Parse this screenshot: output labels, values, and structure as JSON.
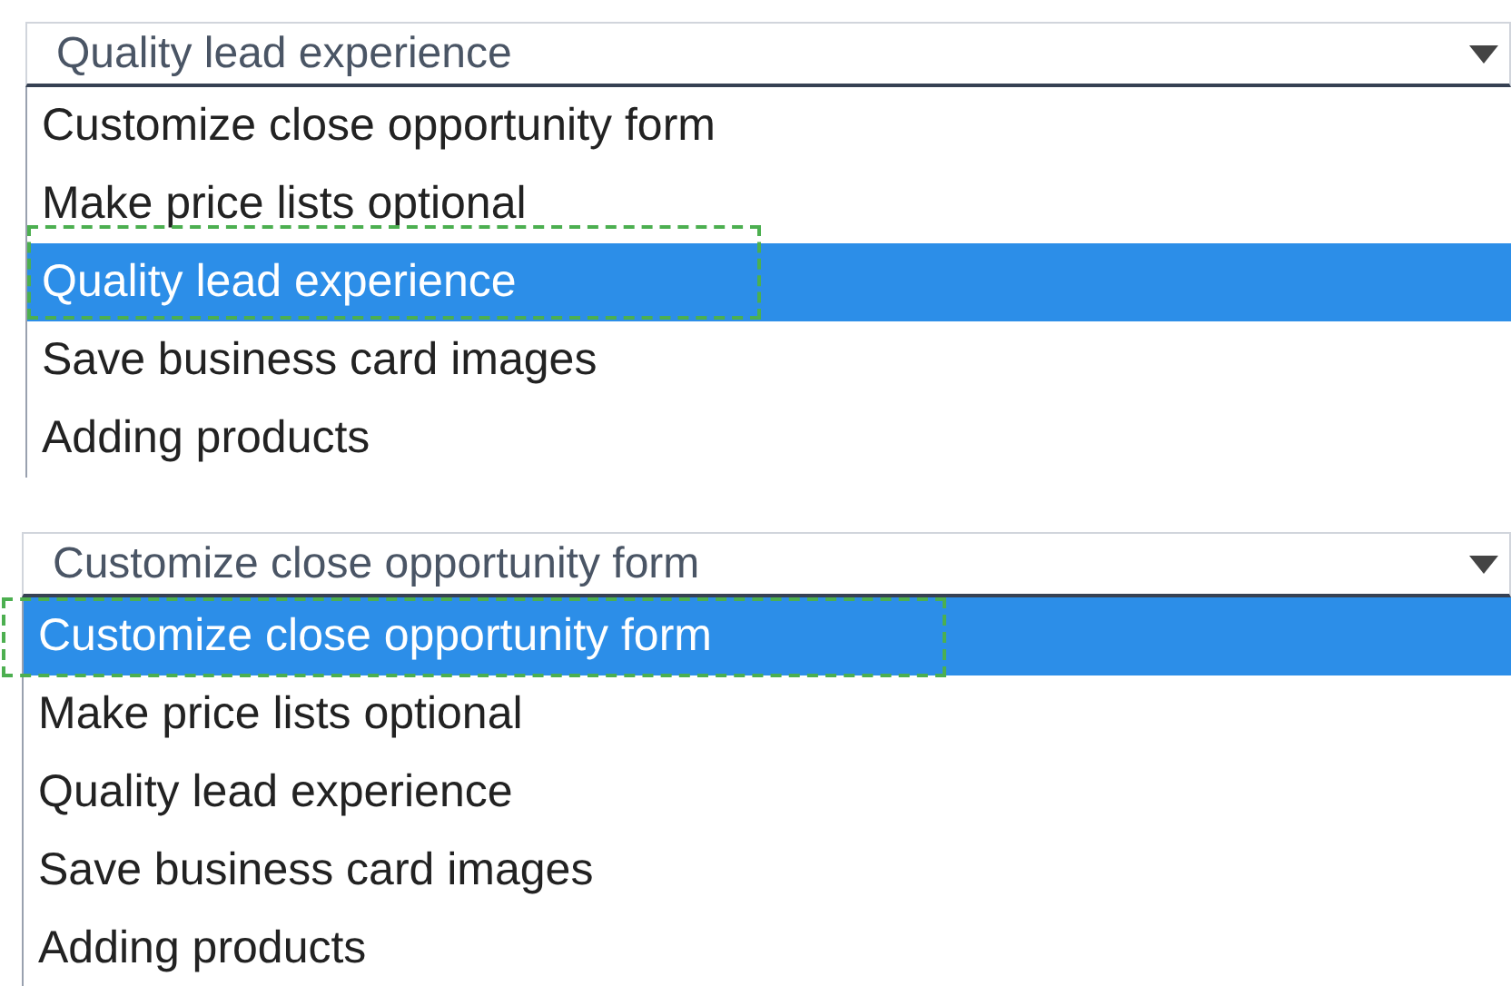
{
  "dropdowns": [
    {
      "value": "Quality lead experience",
      "options": [
        {
          "label": "Customize close opportunity form",
          "selected": false
        },
        {
          "label": "Make price lists optional",
          "selected": false
        },
        {
          "label": "Quality lead experience",
          "selected": true
        },
        {
          "label": "Save business card images",
          "selected": false
        },
        {
          "label": "Adding products",
          "selected": false
        }
      ]
    },
    {
      "value": "Customize close opportunity form",
      "options": [
        {
          "label": "Customize close opportunity form",
          "selected": true
        },
        {
          "label": "Make price lists optional",
          "selected": false
        },
        {
          "label": "Quality lead experience",
          "selected": false
        },
        {
          "label": "Save business card images",
          "selected": false
        },
        {
          "label": "Adding products",
          "selected": false
        }
      ]
    }
  ]
}
